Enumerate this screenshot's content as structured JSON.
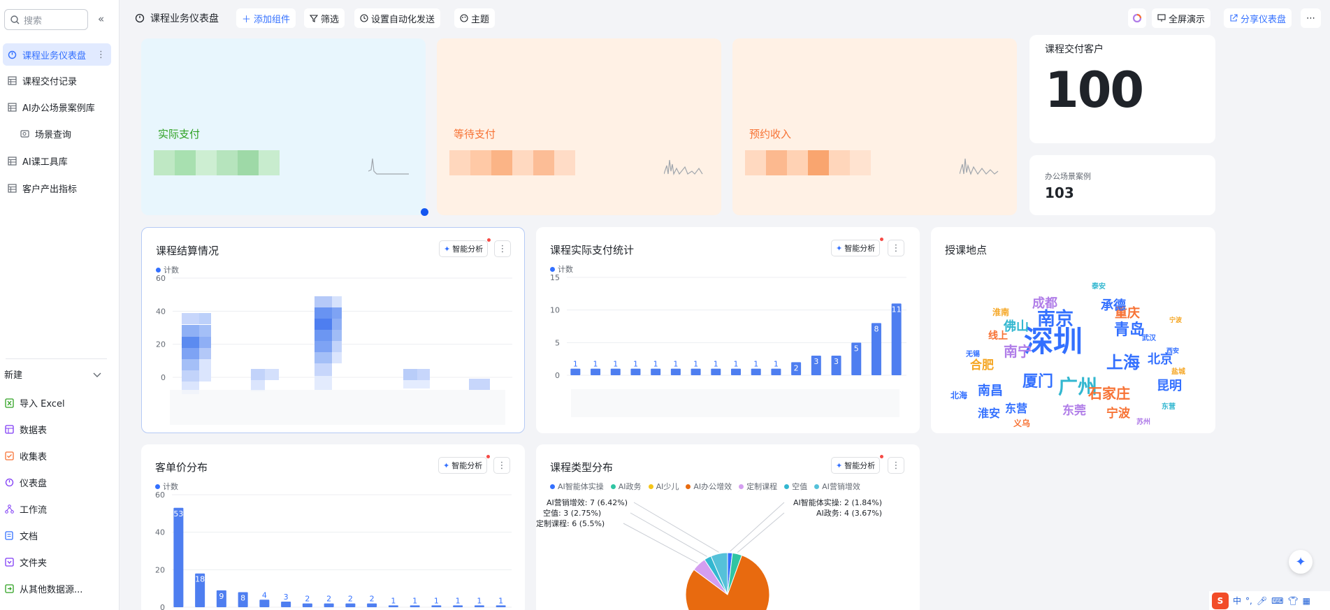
{
  "sidebar": {
    "search_placeholder": "搜索",
    "items": [
      {
        "label": "课程业务仪表盘",
        "icon": "dashboard-icon",
        "active": true
      },
      {
        "label": "课程交付记录",
        "icon": "table-icon"
      },
      {
        "label": "AI办公场景案例库",
        "icon": "table-icon"
      },
      {
        "label": "场景查询",
        "icon": "view-icon"
      },
      {
        "label": "AI课工具库",
        "icon": "table-icon"
      },
      {
        "label": "客户产出指标",
        "icon": "table-icon"
      }
    ],
    "new_label": "新建",
    "new_items": [
      {
        "label": "导入 Excel",
        "icon": "excel-icon",
        "color": "#2ea121"
      },
      {
        "label": "数据表",
        "icon": "datatable-icon",
        "color": "#7f3bf5"
      },
      {
        "label": "收集表",
        "icon": "form-icon",
        "color": "#f77234"
      },
      {
        "label": "仪表盘",
        "icon": "dashboard-icon",
        "color": "#7f3bf5"
      },
      {
        "label": "工作流",
        "icon": "workflow-icon",
        "color": "#7f3bf5"
      },
      {
        "label": "文档",
        "icon": "doc-icon",
        "color": "#3370ff"
      },
      {
        "label": "文件夹",
        "icon": "folder-icon",
        "color": "#7f3bf5"
      },
      {
        "label": "从其他数据源...",
        "icon": "import-icon",
        "color": "#2ea121"
      }
    ]
  },
  "topbar": {
    "title": "课程业务仪表盘",
    "add_widget": "添加组件",
    "filter": "筛选",
    "automation": "设置自动化发送",
    "theme": "主题",
    "fullscreen": "全屏演示",
    "share": "分享仪表盘"
  },
  "stats": {
    "actual_pay": "实际支付",
    "pending_pay": "等待支付",
    "expected_income": "预约收入",
    "customers_label": "课程交付客户",
    "customers_value": "100",
    "cases_label": "办公场景案例",
    "cases_value": "103"
  },
  "common": {
    "ai_label": "智能分析",
    "count_label": "计数"
  },
  "colors": {
    "accent": "#3370ff",
    "bar": "#4e7ef0",
    "actual_bg": "#e8f6fd",
    "pending_bg": "#fff1e5"
  },
  "chart_data": [
    {
      "type": "bar",
      "title": "课程结算情况",
      "legend": [
        "计数"
      ],
      "ylim": [
        0,
        60
      ],
      "yticks": [
        "60",
        "40",
        "20",
        "0"
      ],
      "categories_blurred": true
    },
    {
      "type": "bar",
      "title": "课程实际支付统计",
      "legend": [
        "计数"
      ],
      "ylim": [
        0,
        15
      ],
      "yticks": [
        "15",
        "10",
        "5",
        "0"
      ],
      "values": [
        1,
        1,
        1,
        1,
        1,
        1,
        1,
        1,
        1,
        1,
        1,
        2,
        3,
        3,
        5,
        8,
        11
      ]
    },
    {
      "type": "wordcloud",
      "title": "授课地点",
      "words": [
        {
          "text": "深圳",
          "size": 42,
          "color": "#3370ff"
        },
        {
          "text": "广州",
          "size": 28,
          "color": "#33b7d0"
        },
        {
          "text": "南京",
          "size": 26,
          "color": "#3370ff"
        },
        {
          "text": "上海",
          "size": 24,
          "color": "#3370ff"
        },
        {
          "text": "厦门",
          "size": 22,
          "color": "#3370ff"
        },
        {
          "text": "青岛",
          "size": 22,
          "color": "#3370ff"
        },
        {
          "text": "南宁",
          "size": 20,
          "color": "#b07de8"
        },
        {
          "text": "成都",
          "size": 18,
          "color": "#b07de8"
        },
        {
          "text": "佛山",
          "size": 18,
          "color": "#33b7d0"
        },
        {
          "text": "重庆",
          "size": 18,
          "color": "#f77234"
        },
        {
          "text": "承德",
          "size": 18,
          "color": "#3370ff"
        },
        {
          "text": "北京",
          "size": 18,
          "color": "#3370ff"
        },
        {
          "text": "昆明",
          "size": 18,
          "color": "#3370ff"
        },
        {
          "text": "石家庄",
          "size": 20,
          "color": "#f77234"
        },
        {
          "text": "南昌",
          "size": 18,
          "color": "#3370ff"
        },
        {
          "text": "合肥",
          "size": 17,
          "color": "#f5a623"
        },
        {
          "text": "东莞",
          "size": 17,
          "color": "#b07de8"
        },
        {
          "text": "宁波",
          "size": 17,
          "color": "#f77234"
        },
        {
          "text": "淮安",
          "size": 16,
          "color": "#3370ff"
        },
        {
          "text": "东营",
          "size": 16,
          "color": "#3370ff"
        },
        {
          "text": "线上",
          "size": 14,
          "color": "#f77234"
        },
        {
          "text": "淮南",
          "size": 12,
          "color": "#f5a623"
        },
        {
          "text": "北海",
          "size": 12,
          "color": "#3370ff"
        },
        {
          "text": "义乌",
          "size": 12,
          "color": "#f77234"
        },
        {
          "text": "无锡",
          "size": 10,
          "color": "#3370ff"
        },
        {
          "text": "武汉",
          "size": 10,
          "color": "#3370ff"
        },
        {
          "text": "泰安",
          "size": 10,
          "color": "#33b7d0"
        },
        {
          "text": "盐城",
          "size": 10,
          "color": "#f5a623"
        },
        {
          "text": "苏州",
          "size": 10,
          "color": "#b07de8"
        },
        {
          "text": "西安",
          "size": 9,
          "color": "#3370ff"
        },
        {
          "text": "东营",
          "size": 10,
          "color": "#33b7d0"
        },
        {
          "text": "宁波",
          "size": 9,
          "color": "#f5a623"
        }
      ]
    },
    {
      "type": "bar",
      "title": "客单价分布",
      "legend": [
        "计数"
      ],
      "ylim": [
        0,
        60
      ],
      "yticks": [
        "60",
        "40",
        "20",
        "0"
      ],
      "values": [
        53,
        18,
        9,
        8,
        4,
        3,
        2,
        2,
        2,
        2,
        1,
        1,
        1,
        1,
        1,
        1
      ]
    },
    {
      "type": "pie",
      "title": "课程类型分布",
      "series": [
        {
          "name": "AI智能体实操",
          "value": 2,
          "pct": "1.84%",
          "color": "#3370ff"
        },
        {
          "name": "AI政务",
          "value": 4,
          "pct": "3.67%",
          "color": "#2fc5a3"
        },
        {
          "name": "AI少儿",
          "value": 0,
          "pct": "",
          "color": "#f5c518"
        },
        {
          "name": "AI办公增效",
          "value": 86,
          "pct": "",
          "color": "#e86a0f"
        },
        {
          "name": "定制课程",
          "value": 6,
          "pct": "5.5%",
          "color": "#d49ef0"
        },
        {
          "name": "空值",
          "value": 3,
          "pct": "2.75%",
          "color": "#33b7d0"
        },
        {
          "name": "AI营销增效",
          "value": 7,
          "pct": "6.42%",
          "color": "#55c1d9"
        }
      ],
      "labels": [
        "AI营销增效: 7 (6.42%)",
        "空值: 3 (2.75%)",
        "定制课程: 6 (5.5%)",
        "AI智能体实操: 2 (1.84%)",
        "AI政务: 4 (3.67%)"
      ]
    }
  ]
}
